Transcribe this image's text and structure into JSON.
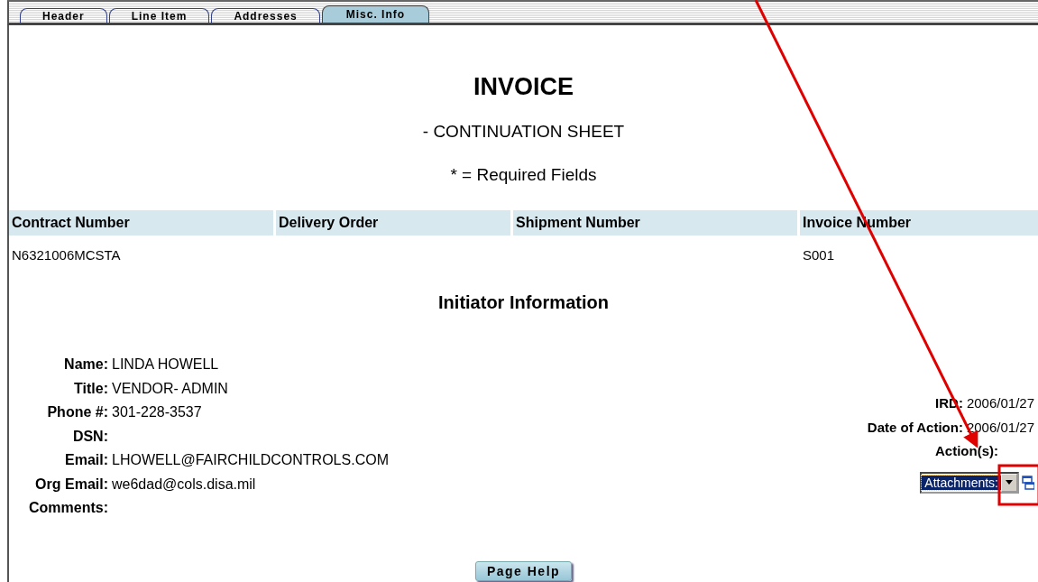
{
  "tabs": [
    {
      "label": "Header",
      "selected": false
    },
    {
      "label": "Line Item",
      "selected": false
    },
    {
      "label": "Addresses",
      "selected": false
    },
    {
      "label": "Misc. Info",
      "selected": true
    }
  ],
  "title": "INVOICE",
  "subtitle": "- CONTINUATION SHEET",
  "required_note": "* = Required Fields",
  "table": {
    "columns": [
      "Contract Number",
      "Delivery Order",
      "Shipment Number",
      "Invoice Number"
    ],
    "rows": [
      [
        "N6321006MCSTA",
        "",
        "",
        "S001"
      ]
    ]
  },
  "section_title": "Initiator Information",
  "initiator": [
    {
      "label": "Name:",
      "value": "LINDA  HOWELL"
    },
    {
      "label": "Title:",
      "value": "VENDOR- ADMIN"
    },
    {
      "label": "Phone #:",
      "value": "301-228-3537"
    },
    {
      "label": "DSN:"
    },
    {
      "label": "Email:",
      "value": "LHOWELL@FAIRCHILDCONTROLS.COM"
    },
    {
      "label": "Org Email:",
      "value": "we6dad@cols.disa.mil"
    },
    {
      "label": "Comments:"
    }
  ],
  "dates": [
    {
      "label": "IRD:",
      "value": "2006/01/27"
    },
    {
      "label": "Date of Action:",
      "value": "2006/01/27"
    }
  ],
  "actions": {
    "label": "Action(s):",
    "value": "Attachments:"
  },
  "page_help_button": "Page Help"
}
